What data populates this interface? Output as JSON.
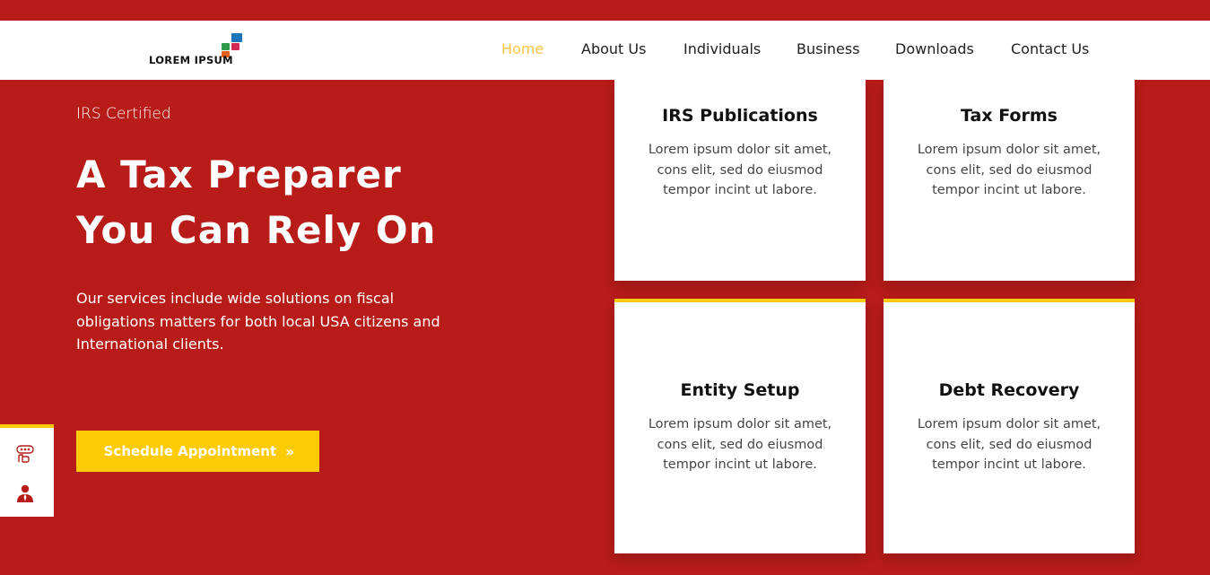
{
  "brand": {
    "logo_text": "LOREM IPSUM",
    "square_colors": [
      "#2e9b48",
      "#1b75bb",
      "#e25f1d",
      "#d42b56"
    ]
  },
  "nav": {
    "items": [
      {
        "label": "Home",
        "active": true
      },
      {
        "label": "About Us",
        "active": false
      },
      {
        "label": "Individuals",
        "active": false
      },
      {
        "label": "Business",
        "active": false
      },
      {
        "label": "Downloads",
        "active": false
      },
      {
        "label": "Contact Us",
        "active": false
      }
    ],
    "active_color": "#f7c545",
    "text_color": "#222222"
  },
  "hero": {
    "eyebrow": "IRS Certified",
    "title_line1": "A Tax Preparer",
    "title_line2": "You Can Rely On",
    "description": "Our services include wide solutions on fiscal obligations matters for both local USA citizens and International clients.",
    "cta_label": "Schedule Appointment",
    "cta_icon": "double-chevron-right-icon"
  },
  "side_widget": {
    "icons": [
      "consultation-icon",
      "user-icon"
    ]
  },
  "services": [
    {
      "title": "IRS Publications",
      "text": "Lorem ipsum dolor sit amet, cons elit, sed do eiusmod tempor incint ut labore."
    },
    {
      "title": "Tax Forms",
      "text": "Lorem ipsum dolor sit amet, cons elit, sed do eiusmod tempor incint ut labore."
    },
    {
      "title": "Entity Setup",
      "text": "Lorem ipsum dolor sit amet, cons elit, sed do eiusmod tempor incint ut labore."
    },
    {
      "title": "Debt Recovery",
      "text": "Lorem ipsum dolor sit amet, cons elit, sed do eiusmod tempor incint ut labore."
    }
  ],
  "colors": {
    "primary_red": "#b71c18",
    "accent_yellow": "#fccb06",
    "white": "#ffffff"
  }
}
